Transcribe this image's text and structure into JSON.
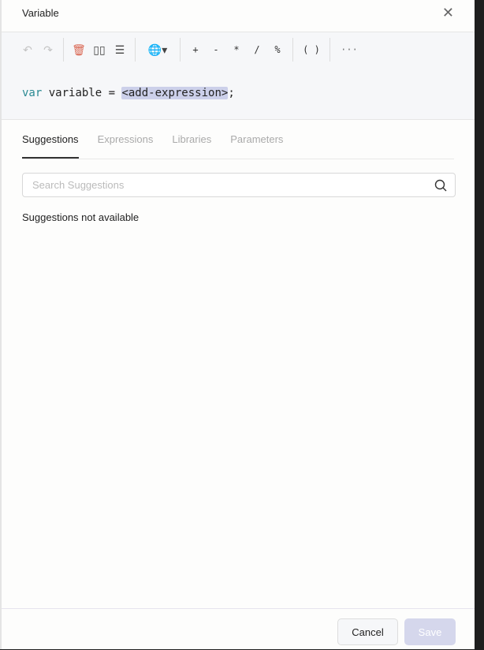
{
  "header": {
    "title": "Variable",
    "close": "✕"
  },
  "toolbar": {
    "undo": "↶",
    "redo": "↷",
    "delete": "🗑",
    "columns": "▯▯",
    "document": "☰",
    "globe": "🌐▾",
    "ops": [
      "+",
      "-",
      "*",
      "/",
      "%"
    ],
    "parens": "( )",
    "more": "···"
  },
  "editor": {
    "keyword": "var",
    "rest": " variable = ",
    "placeholder": "<add-expression>",
    "end": ";"
  },
  "tabs": [
    {
      "label": "Suggestions"
    },
    {
      "label": "Expressions"
    },
    {
      "label": "Libraries"
    },
    {
      "label": "Parameters"
    }
  ],
  "search": {
    "placeholder": "Search Suggestions"
  },
  "message": "Suggestions not available",
  "footer": {
    "cancel": "Cancel",
    "save": "Save"
  }
}
